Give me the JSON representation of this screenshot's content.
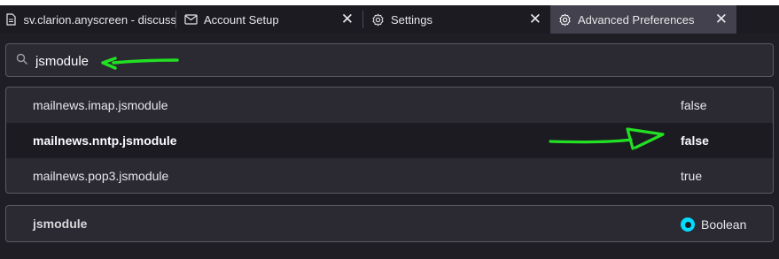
{
  "tabs": [
    {
      "label": "sv.clarion.anyscreen - discuss.sc",
      "icon": "document-icon"
    },
    {
      "label": "Account Setup",
      "icon": "mail-icon"
    },
    {
      "label": "Settings",
      "icon": "gear-icon"
    },
    {
      "label": "Advanced Preferences",
      "icon": "gear-icon",
      "active": true
    }
  ],
  "close_glyph": "✕",
  "search": {
    "value": "jsmodule",
    "icon": "search-icon"
  },
  "prefs": [
    {
      "name": "mailnews.imap.jsmodule",
      "value": "false",
      "modified": false
    },
    {
      "name": "mailnews.nntp.jsmodule",
      "value": "false",
      "modified": true
    },
    {
      "name": "mailnews.pop3.jsmodule",
      "value": "true",
      "modified": false
    }
  ],
  "new_pref": {
    "name": "jsmodule",
    "type_label": "Boolean",
    "selected": true
  },
  "colors": {
    "annotation": "#22e022",
    "accent": "#00ddff"
  }
}
